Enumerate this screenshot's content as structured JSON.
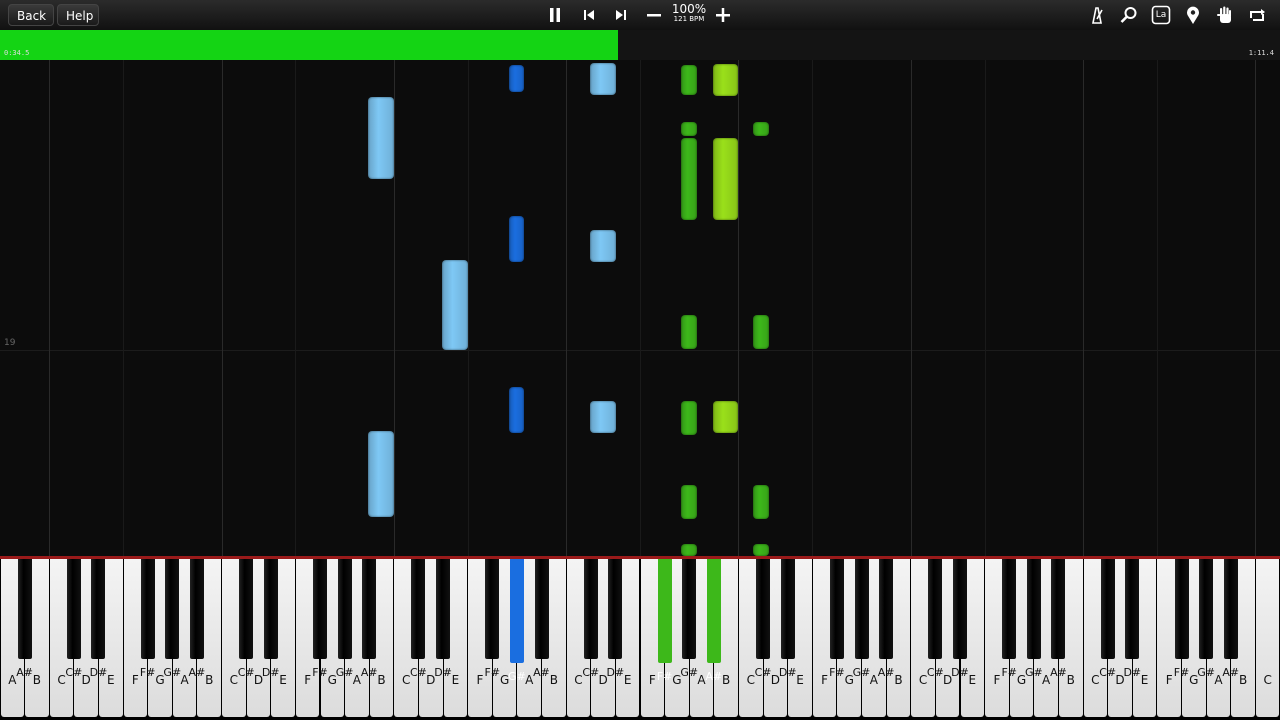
{
  "toolbar": {
    "back_label": "Back",
    "help_label": "Help",
    "speed_percent": "100%",
    "tempo": "121 BPM",
    "right_icons": [
      "metronome-icon",
      "search-icon",
      "label-icon",
      "location-pin-icon",
      "hand-icon",
      "loop-icon"
    ],
    "label_icon_text": "La"
  },
  "progress": {
    "fraction": 0.483,
    "current_time": "0:34.5",
    "total_time": "1:11.4"
  },
  "roll": {
    "measure_label": "19"
  },
  "colors": {
    "progress": "#14d414",
    "light_blue": "#7ec8f5",
    "dark_blue": "#1a6ee0",
    "lime": "#9ae01a",
    "green": "#3db81a"
  },
  "keyboard": {
    "start_note": "A",
    "white_labels": [
      "A",
      "B",
      "C",
      "D",
      "E",
      "F",
      "G",
      "A",
      "B",
      "C",
      "D",
      "E",
      "F",
      "G",
      "A",
      "B",
      "C",
      "D",
      "E",
      "F",
      "G",
      "A",
      "B",
      "C",
      "D",
      "E",
      "F",
      "G",
      "A",
      "B",
      "C",
      "D",
      "E",
      "F",
      "G",
      "A",
      "B",
      "C",
      "D",
      "E",
      "F",
      "G",
      "A",
      "B",
      "C",
      "D",
      "E",
      "F",
      "G",
      "A",
      "B",
      "C"
    ],
    "pressed_keys": [
      "G#",
      "G#",
      "C#"
    ]
  }
}
